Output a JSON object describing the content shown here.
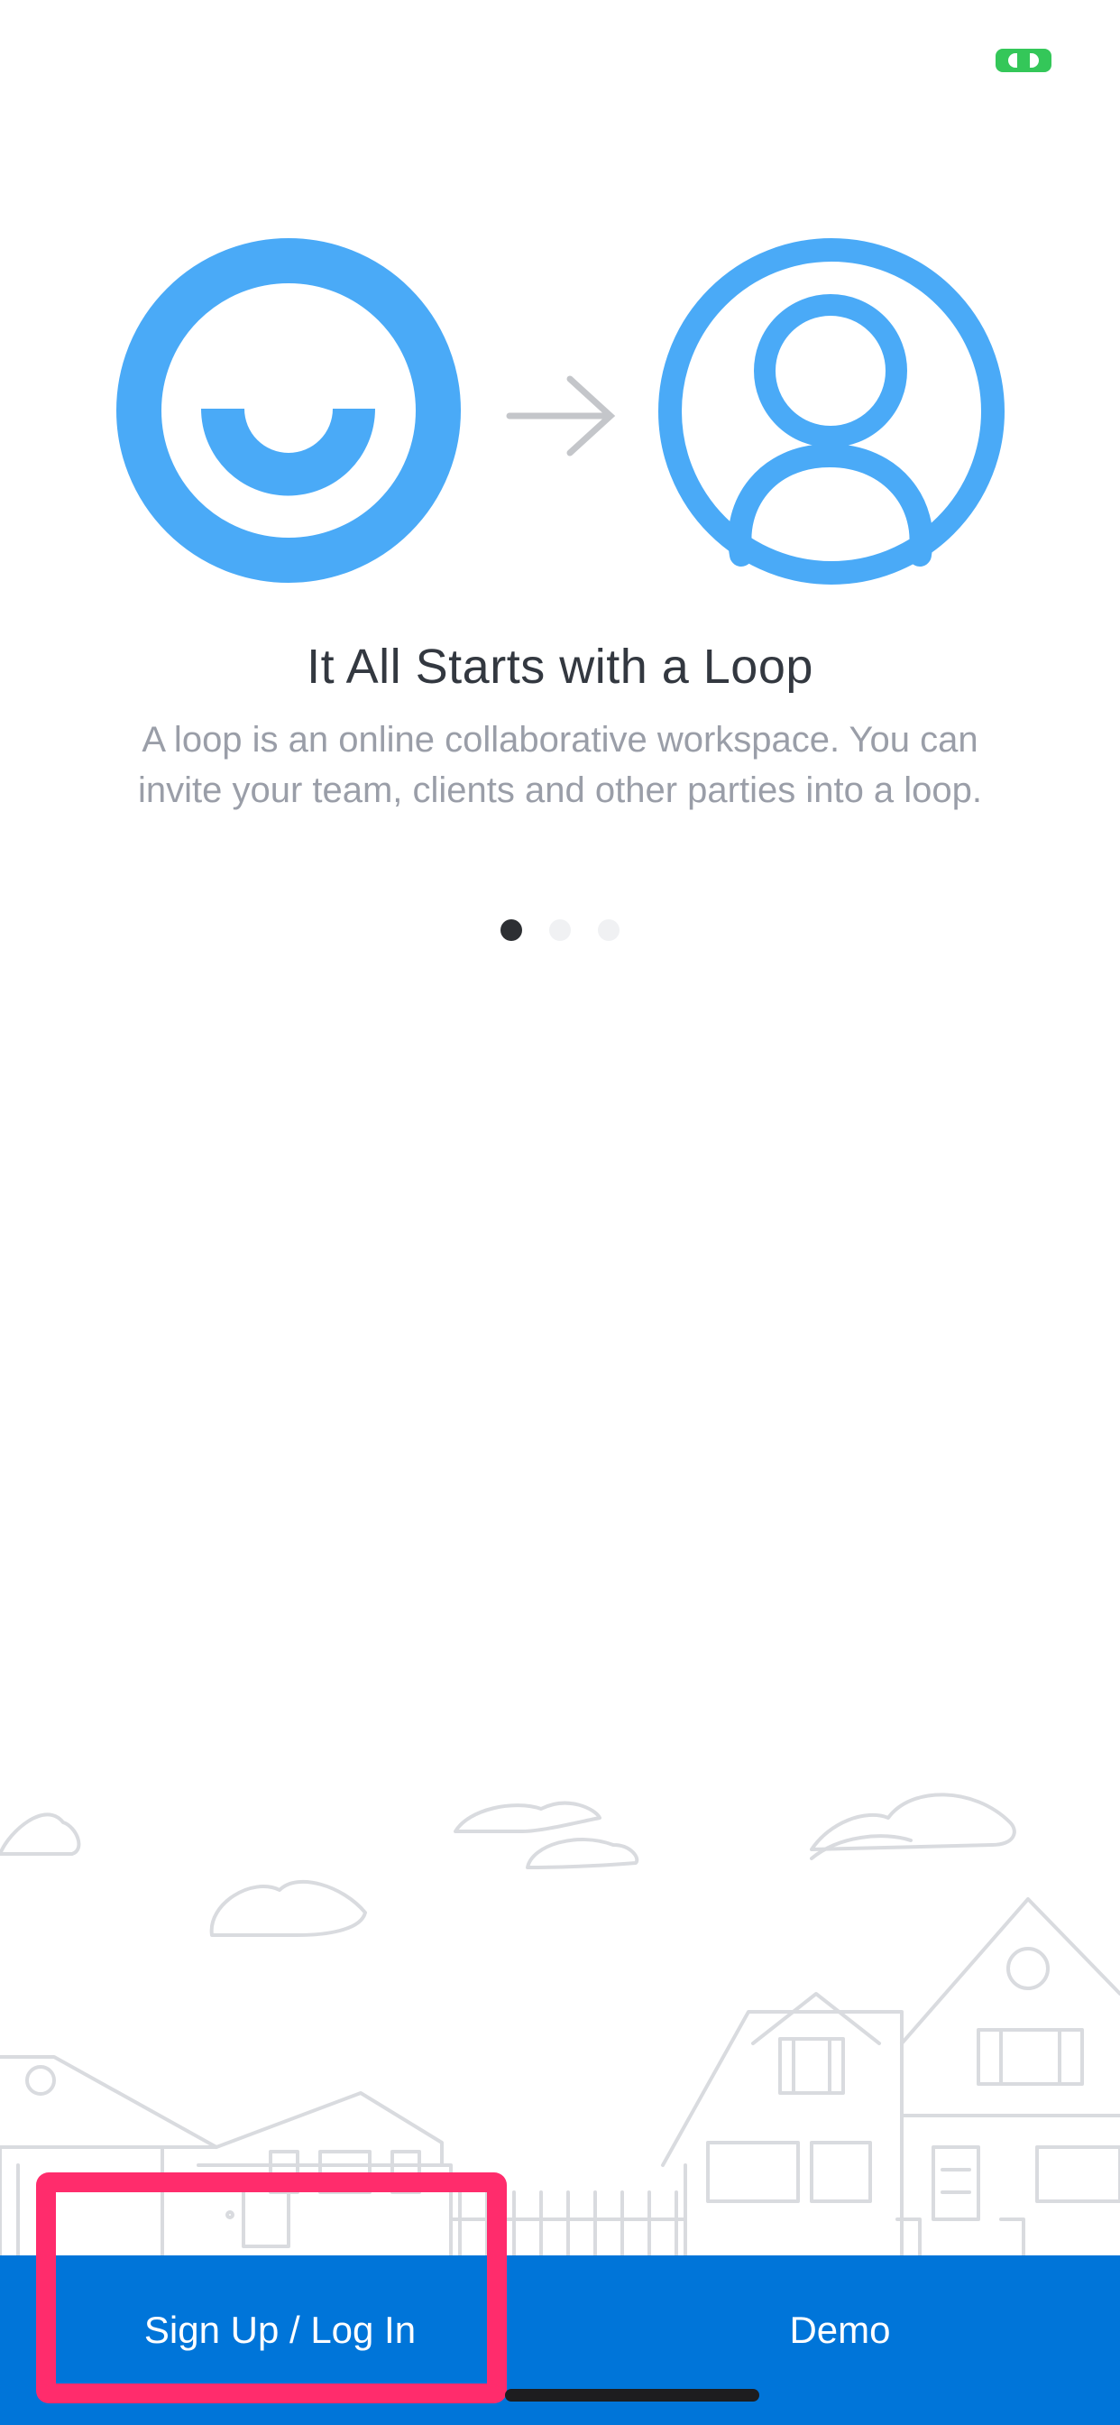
{
  "onboarding": {
    "title": "It All Starts with a Loop",
    "description": "A loop is an online collaborative workspace. You can invite your team, clients and other parties into a loop.",
    "pagination": {
      "current": 1,
      "total": 3
    }
  },
  "bottom_bar": {
    "signup_label": "Sign Up / Log In",
    "demo_label": "Demo"
  },
  "colors": {
    "accent": "#4aaaf7",
    "bar": "#0075d9",
    "highlight": "#ff2c6c"
  },
  "icons": {
    "loop_logo": "loop-logo-icon",
    "arrow": "arrow-right-icon",
    "user": "user-profile-icon"
  }
}
